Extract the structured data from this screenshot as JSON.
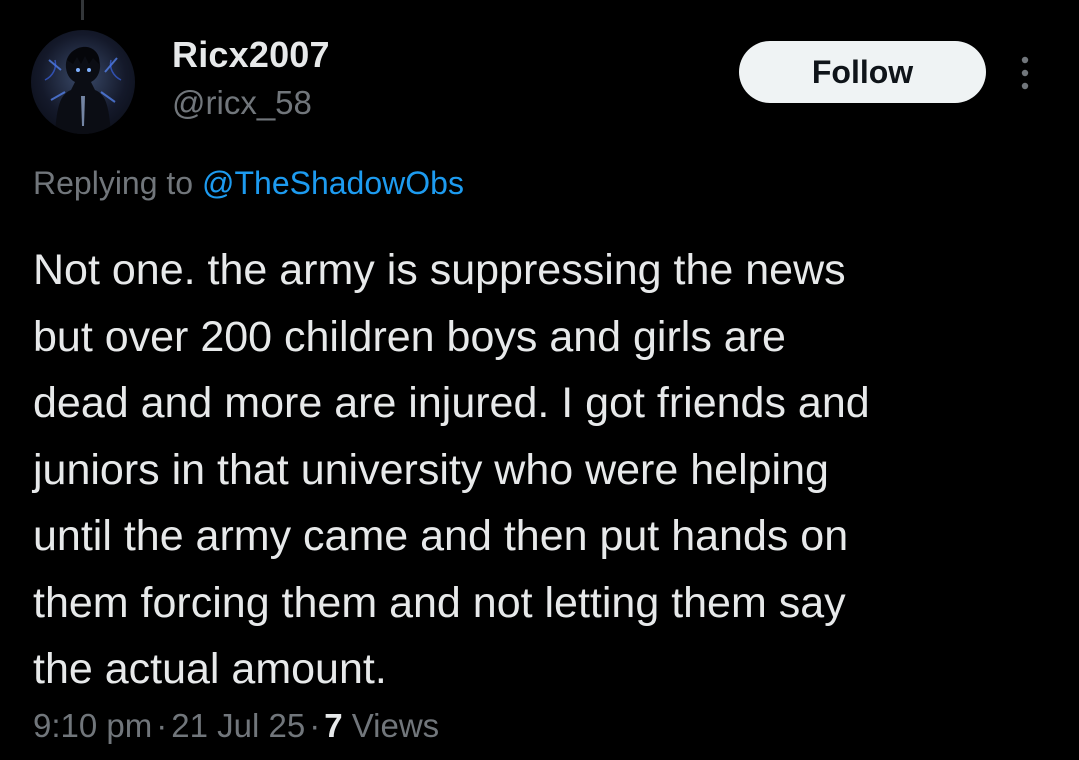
{
  "tweet": {
    "author": {
      "display_name": "Ricx2007",
      "handle": "@ricx_58",
      "avatar_icon": "dark-anime-character-avatar"
    },
    "follow_label": "Follow",
    "more_icon": "vertical-ellipsis-icon",
    "reply": {
      "prefix": "Replying to ",
      "mention": "@TheShadowObs"
    },
    "text": "Not one. the army is suppressing the news\nbut over 200 children boys and girls are\ndead and more are injured. I got friends and\njuniors in that university who were helping\nuntil the army came and then put hands on\nthem forcing them and not letting them say\nthe actual amount.",
    "meta": {
      "time": "9:10 pm",
      "separator": "·",
      "date": "21 Jul 25",
      "views_count": "7",
      "views_label": " Views"
    }
  },
  "colors": {
    "background": "#000000",
    "primary_text": "#e7e9ea",
    "secondary_text": "#71767b",
    "link": "#1d9bf0",
    "button_bg": "#eff3f4",
    "button_text": "#0f1419"
  }
}
